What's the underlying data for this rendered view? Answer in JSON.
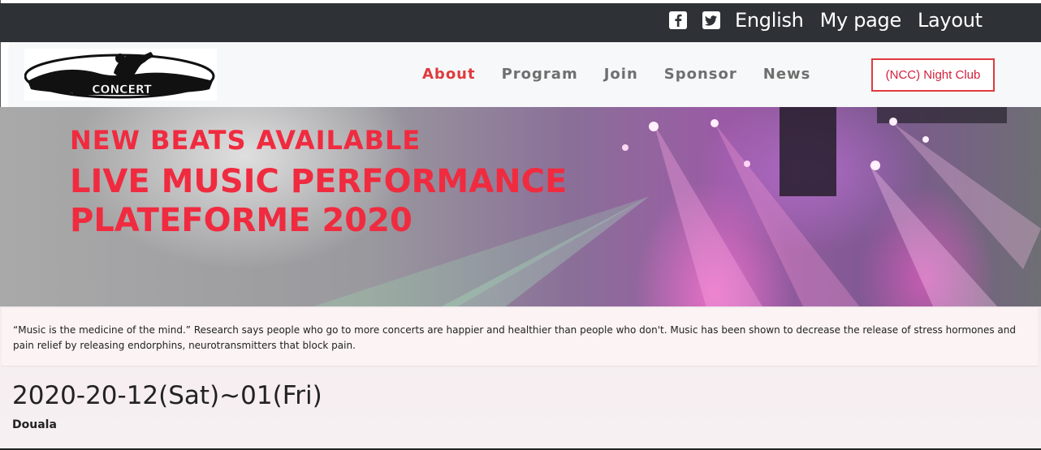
{
  "topbar": {
    "social": [
      {
        "name": "facebook-icon"
      },
      {
        "name": "twitter-icon"
      }
    ],
    "links": [
      "English",
      "My page",
      "Layout"
    ]
  },
  "navbar": {
    "logo_text": "CONCERT",
    "items": [
      {
        "label": "About",
        "active": true
      },
      {
        "label": "Program",
        "active": false
      },
      {
        "label": "Join",
        "active": false
      },
      {
        "label": "Sponsor",
        "active": false
      },
      {
        "label": "News",
        "active": false
      }
    ],
    "cta_label": "(NCC) Night Club"
  },
  "hero": {
    "title_line1": "NEW BEATS AVAILABLE",
    "title_line2": "LIVE MUSIC PERFORMANCE PLATEFORME 2020"
  },
  "info": {
    "quote": "“Music is the medicine of the mind.” Research says people who go to more concerts are happier and healthier than people who don't. Music has been shown to decrease the release of stress hormones and pain relief by releasing endorphins, neurotransmitters that block pain.",
    "date": "2020-20-12(Sat)~01(Fri)",
    "city": "Douala"
  },
  "colors": {
    "accent": "#e03a3e",
    "topbar_bg": "#2e3136"
  }
}
